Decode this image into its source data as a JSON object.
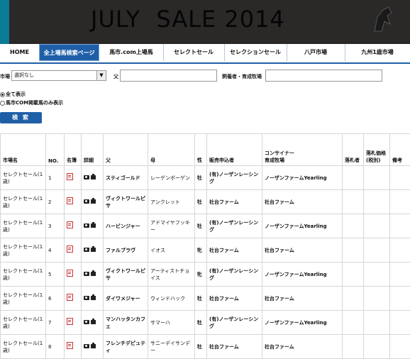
{
  "banner": {
    "title": "JULY  SALE 2014"
  },
  "nav": {
    "tabs": [
      {
        "label": "HOME"
      },
      {
        "label": "全上場馬検索ページ"
      },
      {
        "label": "馬市.com上場馬"
      },
      {
        "label": "セレクトセール"
      },
      {
        "label": "セレクションセール"
      },
      {
        "label": "八戸市場"
      },
      {
        "label": "九州1歳市場"
      }
    ]
  },
  "filters": {
    "market_label": "市場",
    "market_value": "選択なし",
    "sire_label": "父",
    "breeder_label": "飼養者・育成牧場",
    "radio_all": "全て表示",
    "radio_com": "馬市COM掲載馬のみ表示",
    "search_button": "検 索"
  },
  "table": {
    "headers": [
      "市場名",
      "NO.",
      "名簿",
      "詳細",
      "父",
      "母",
      "性",
      "販売申込者",
      "コンサイナー\n育成牧場",
      "落札者",
      "落札価格\n(税別)",
      "備考"
    ],
    "rows": [
      {
        "market": "セレクトセール(1歳)",
        "no": "1",
        "sire": "スティゴールド",
        "dam": "レーゲンボーゲン",
        "sex": "牡",
        "seller": "(有)ノーザンレーシング",
        "consignor": "ノーザンファームYearling"
      },
      {
        "market": "セレクトセール(1歳)",
        "no": "2",
        "sire": "ヴィクトワールピサ",
        "dam": "アンクレット",
        "sex": "牡",
        "seller": "社台ファーム",
        "consignor": "社台ファーム"
      },
      {
        "market": "セレクトセール(1歳)",
        "no": "3",
        "sire": "ハービンジャー",
        "dam": "アドマイヤフッキー",
        "sex": "牡",
        "seller": "(有)ノーザンレーシング",
        "consignor": "ノーザンファームYearling"
      },
      {
        "market": "セレクトセール(1歳)",
        "no": "4",
        "sire": "ファルブラヴ",
        "dam": "イオス",
        "sex": "牝",
        "seller": "社台ファーム",
        "consignor": "社台ファーム"
      },
      {
        "market": "セレクトセール(1歳)",
        "no": "5",
        "sire": "ヴィクトワールピサ",
        "dam": "アーティストチョイス",
        "sex": "牝",
        "seller": "(有)ノーザンレーシング",
        "consignor": "ノーザンファームYearling"
      },
      {
        "market": "セレクトセール(1歳)",
        "no": "6",
        "sire": "ダイワメジャー",
        "dam": "ウィンドハック",
        "sex": "牡",
        "seller": "社台ファーム",
        "consignor": "社台ファーム"
      },
      {
        "market": "セレクトセール(1歳)",
        "no": "7",
        "sire": "マンハッタンカフェ",
        "dam": "サマーハ",
        "sex": "牡",
        "seller": "(有)ノーザンレーシング",
        "consignor": "ノーザンファームYearling"
      },
      {
        "market": "セレクトセール(1歳)",
        "no": "8",
        "sire": "フレンチデピュティ",
        "dam": "サニーデイサンデー",
        "sex": "牡",
        "seller": "社台ファーム",
        "consignor": "社台ファーム"
      }
    ]
  }
}
